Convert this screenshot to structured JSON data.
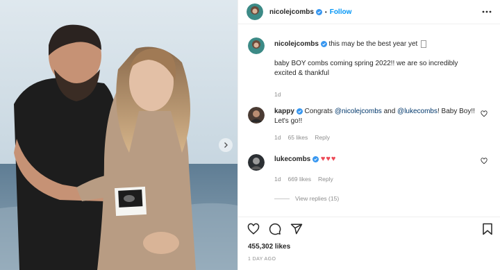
{
  "post": {
    "author": "nicolejcombs",
    "follow_label": "Follow",
    "dot": "•",
    "caption_line1": "this may be the best year yet",
    "caption_line2": "baby BOY combs coming spring 2022!! we are so incredibly excited & thankful",
    "caption_age": "1d",
    "likes": "455,302 likes",
    "time_ago": "1 DAY AGO"
  },
  "comments": [
    {
      "user": "kappy",
      "text_a": "Congrats ",
      "mention1": "@nicolejcombs",
      "text_b": " and ",
      "mention2": "@lukecombs",
      "text_c": "! Baby Boy!! Let's go!!",
      "age": "1d",
      "likes": "65 likes",
      "reply": "Reply"
    },
    {
      "user": "lukecombs",
      "hearts": "♥♥♥",
      "age": "1d",
      "likes": "669 likes",
      "reply": "Reply",
      "view_replies": "View replies (15)"
    }
  ],
  "icons": {
    "like": "heart-icon",
    "comment": "comment-icon",
    "share": "share-icon",
    "save": "bookmark-icon",
    "more": "more-icon",
    "next": "chevron-right-icon"
  },
  "colors": {
    "accent": "#0095f6",
    "verified": "#3897f0",
    "heart": "#ed4956",
    "muted": "#8e8e8e"
  }
}
